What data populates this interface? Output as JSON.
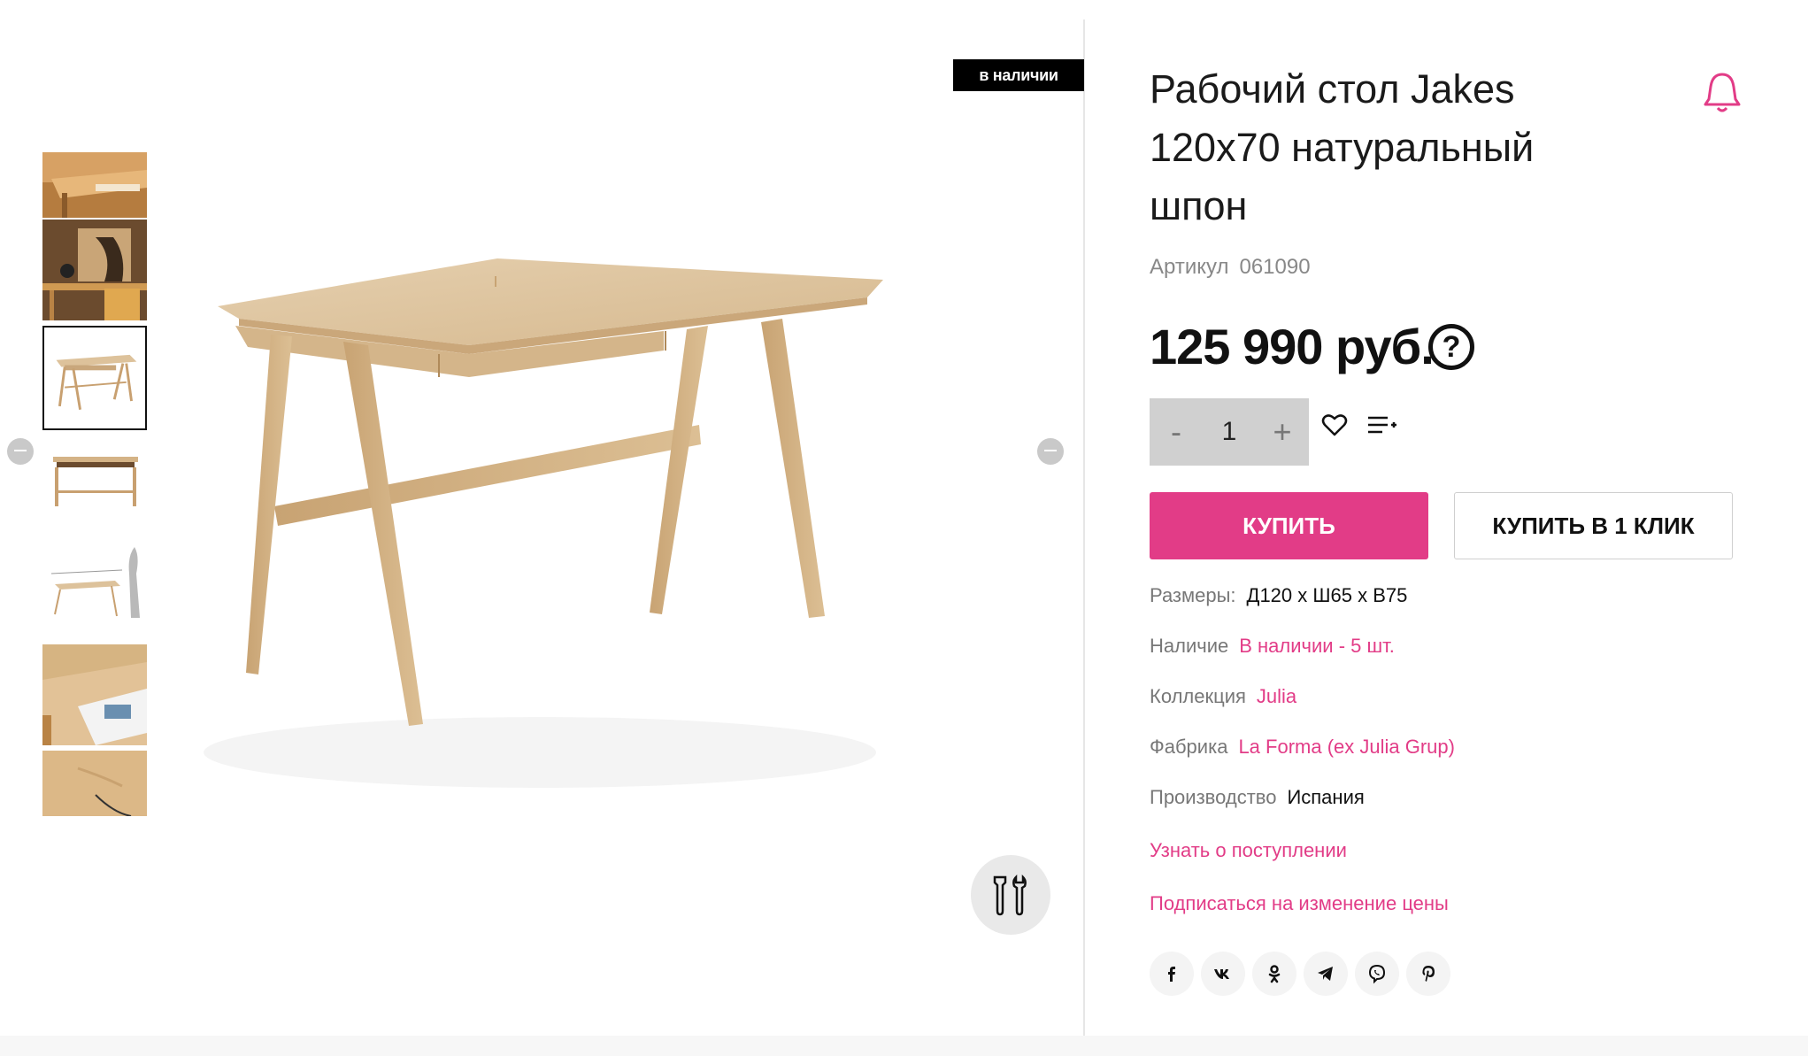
{
  "gallery": {
    "badge": "в наличии",
    "thumbnails": [
      {
        "icon": "desk-drawer-closeup"
      },
      {
        "icon": "desk-interior-scene"
      },
      {
        "icon": "desk-product"
      },
      {
        "icon": "desk-front"
      },
      {
        "icon": "desk-dimensions"
      },
      {
        "icon": "desk-drawer-open"
      },
      {
        "icon": "desk-top-detail"
      }
    ],
    "active_thumbnail": 2
  },
  "product": {
    "title": "Рабочий стол Jakes 120x70 натуральный шпон",
    "sku_label": "Артикул",
    "sku_value": "061090",
    "price": "125 990 руб.",
    "price_help": "?",
    "quantity": "1",
    "qty_minus": "-",
    "qty_plus": "+",
    "buy_label": "КУПИТЬ",
    "oneclick_label": "КУПИТЬ В 1 КЛИК"
  },
  "properties": [
    {
      "label": "Размеры:",
      "value": "Д120 х Ш65 х В75",
      "accent": false
    },
    {
      "label": "Наличие",
      "value": "В наличии - 5 шт.",
      "accent": true
    },
    {
      "label": "Коллекция",
      "value": "Julia",
      "accent": true
    },
    {
      "label": "Фабрика",
      "value": "La Forma (ex Julia Grup)",
      "accent": true
    },
    {
      "label": "Производство",
      "value": "Испания",
      "accent": false
    }
  ],
  "links": {
    "notify_arrival": "Узнать о поступлении",
    "subscribe_price": "Подписаться на изменение цены"
  },
  "socials": [
    {
      "name": "facebook",
      "glyph": "f"
    },
    {
      "name": "vk",
      "glyph": "vk"
    },
    {
      "name": "odnoklassniki",
      "glyph": "ok"
    },
    {
      "name": "telegram",
      "glyph": "tg"
    },
    {
      "name": "viber",
      "glyph": "vb"
    },
    {
      "name": "pinterest",
      "glyph": "p"
    }
  ],
  "colors": {
    "accent": "#e23c87",
    "badge_bg": "#000000",
    "qty_bg": "#d0d0d0",
    "wood": "#d9b98e"
  }
}
